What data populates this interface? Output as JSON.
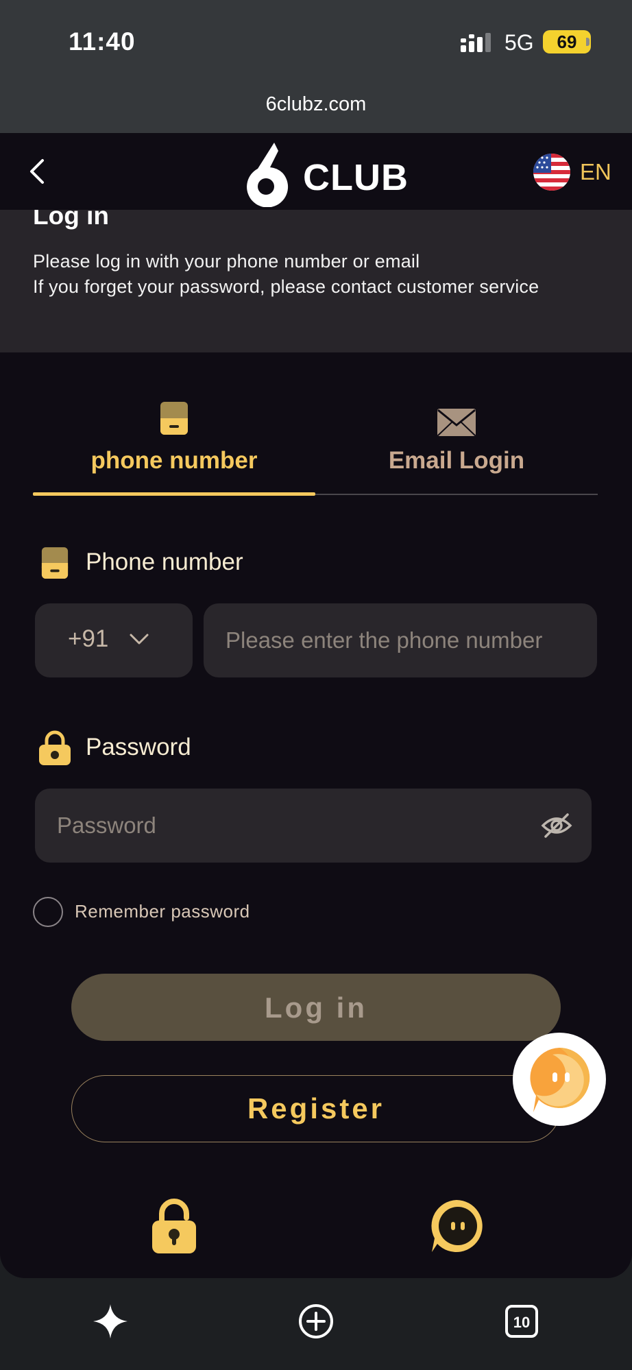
{
  "status_bar": {
    "time": "11:40",
    "network": "5G",
    "battery": "69"
  },
  "browser": {
    "url": "6clubz.com"
  },
  "header": {
    "logo_text": "CLUB",
    "language": "EN",
    "back_icon": "chevron-left-icon",
    "flag_icon": "us-flag-icon"
  },
  "info": {
    "title": "Log in",
    "line1": "Please log in with your phone number or email",
    "line2": "If you forget your password, please contact customer service"
  },
  "tabs": [
    {
      "label": "phone number",
      "icon": "phone-icon",
      "active": true
    },
    {
      "label": "Email Login",
      "icon": "envelope-icon",
      "active": false
    }
  ],
  "form": {
    "phone_label": "Phone number",
    "country_code": "+91",
    "phone_placeholder": "Please enter the phone number",
    "password_label": "Password",
    "password_placeholder": "Password",
    "remember_label": "Remember password"
  },
  "buttons": {
    "login": "Log in",
    "register": "Register"
  },
  "colors": {
    "accent": "#f5c95e",
    "background": "#0f0c14",
    "input_bg": "#29262b",
    "login_btn_bg": "#59503f"
  }
}
